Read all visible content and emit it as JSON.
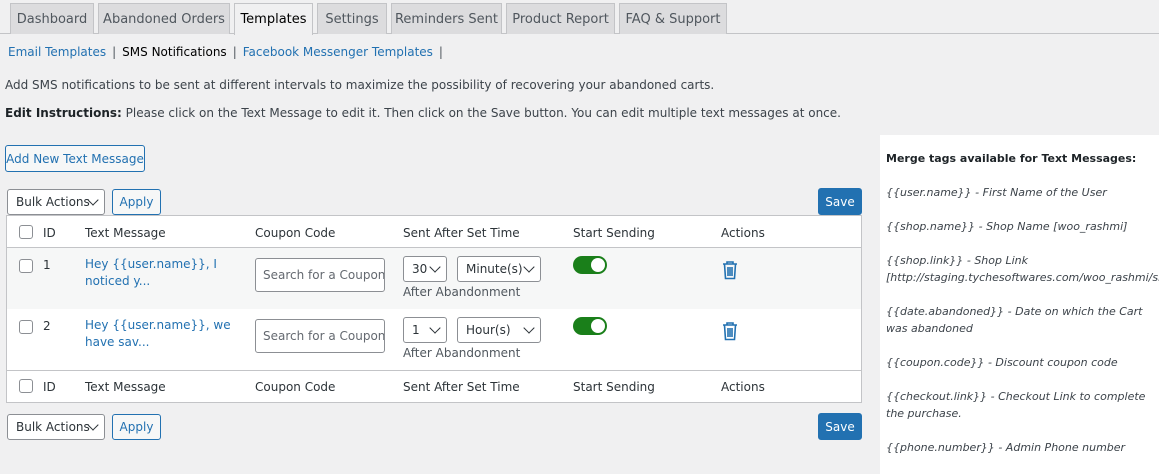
{
  "tabs": [
    "Dashboard",
    "Abandoned Orders",
    "Templates",
    "Settings",
    "Reminders Sent",
    "Product Report",
    "FAQ & Support"
  ],
  "active_tab": "Templates",
  "subnav": {
    "email": "Email Templates",
    "sms": "SMS Notifications",
    "fb": "Facebook Messenger Templates",
    "sep": "|"
  },
  "description": "Add SMS notifications to be sent at different intervals to maximize the possibility of recovering your abandoned carts.",
  "instructions": {
    "label": "Edit Instructions:",
    "text": " Please click on the Text Message to edit it. Then click on the Save button. You can edit multiple text messages at once."
  },
  "add_button": "Add New Text Message",
  "bulk_actions": "Bulk Actions",
  "apply": "Apply",
  "save": "Save",
  "columns": {
    "id": "ID",
    "message": "Text Message",
    "coupon": "Coupon Code",
    "sent_after": "Sent After Set Time",
    "start": "Start Sending",
    "actions": "Actions"
  },
  "rows": [
    {
      "id": "1",
      "message": "Hey {{user.name}}, I noticed y...",
      "coupon_placeholder": "Search for a Coupon...",
      "time_value": "30",
      "time_unit": "Minute(s)",
      "after": "After Abandonment",
      "enabled": true
    },
    {
      "id": "2",
      "message": "Hey {{user.name}}, we have sav...",
      "coupon_placeholder": "Search for a Coupon...",
      "time_value": "1",
      "time_unit": "Hour(s)",
      "after": "After Abandonment",
      "enabled": true
    }
  ],
  "merge_tags": {
    "title": "Merge tags available for Text Messages:",
    "items": [
      "{{user.name}} - First Name of the User",
      "{{shop.name}} - Shop Name [woo_rashmi]",
      "{{shop.link}} - Shop Link [http://staging.tychesoftwares.com/woo_rashmi/shop/]",
      "{{date.abandoned}} - Date on which the Cart was abandoned",
      "{{coupon.code}} - Discount coupon code",
      "{{checkout.link}} - Checkout Link to complete the purchase.",
      "{{phone.number}} - Admin Phone number"
    ]
  },
  "colors": {
    "accent": "#2271b1",
    "toggle_on": "#1a7f1a",
    "background": "#f0f0f1"
  }
}
